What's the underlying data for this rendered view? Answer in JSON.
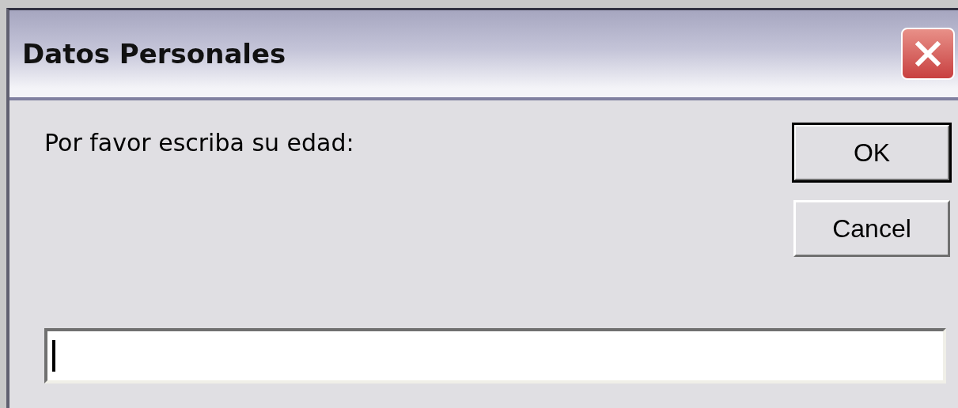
{
  "window": {
    "title": "Datos Personales"
  },
  "prompt": "Por favor escriba su edad:",
  "buttons": [
    {
      "label": "OK",
      "default": true
    },
    {
      "label": "Cancel",
      "default": false
    }
  ],
  "input": {
    "focused": true
  }
}
